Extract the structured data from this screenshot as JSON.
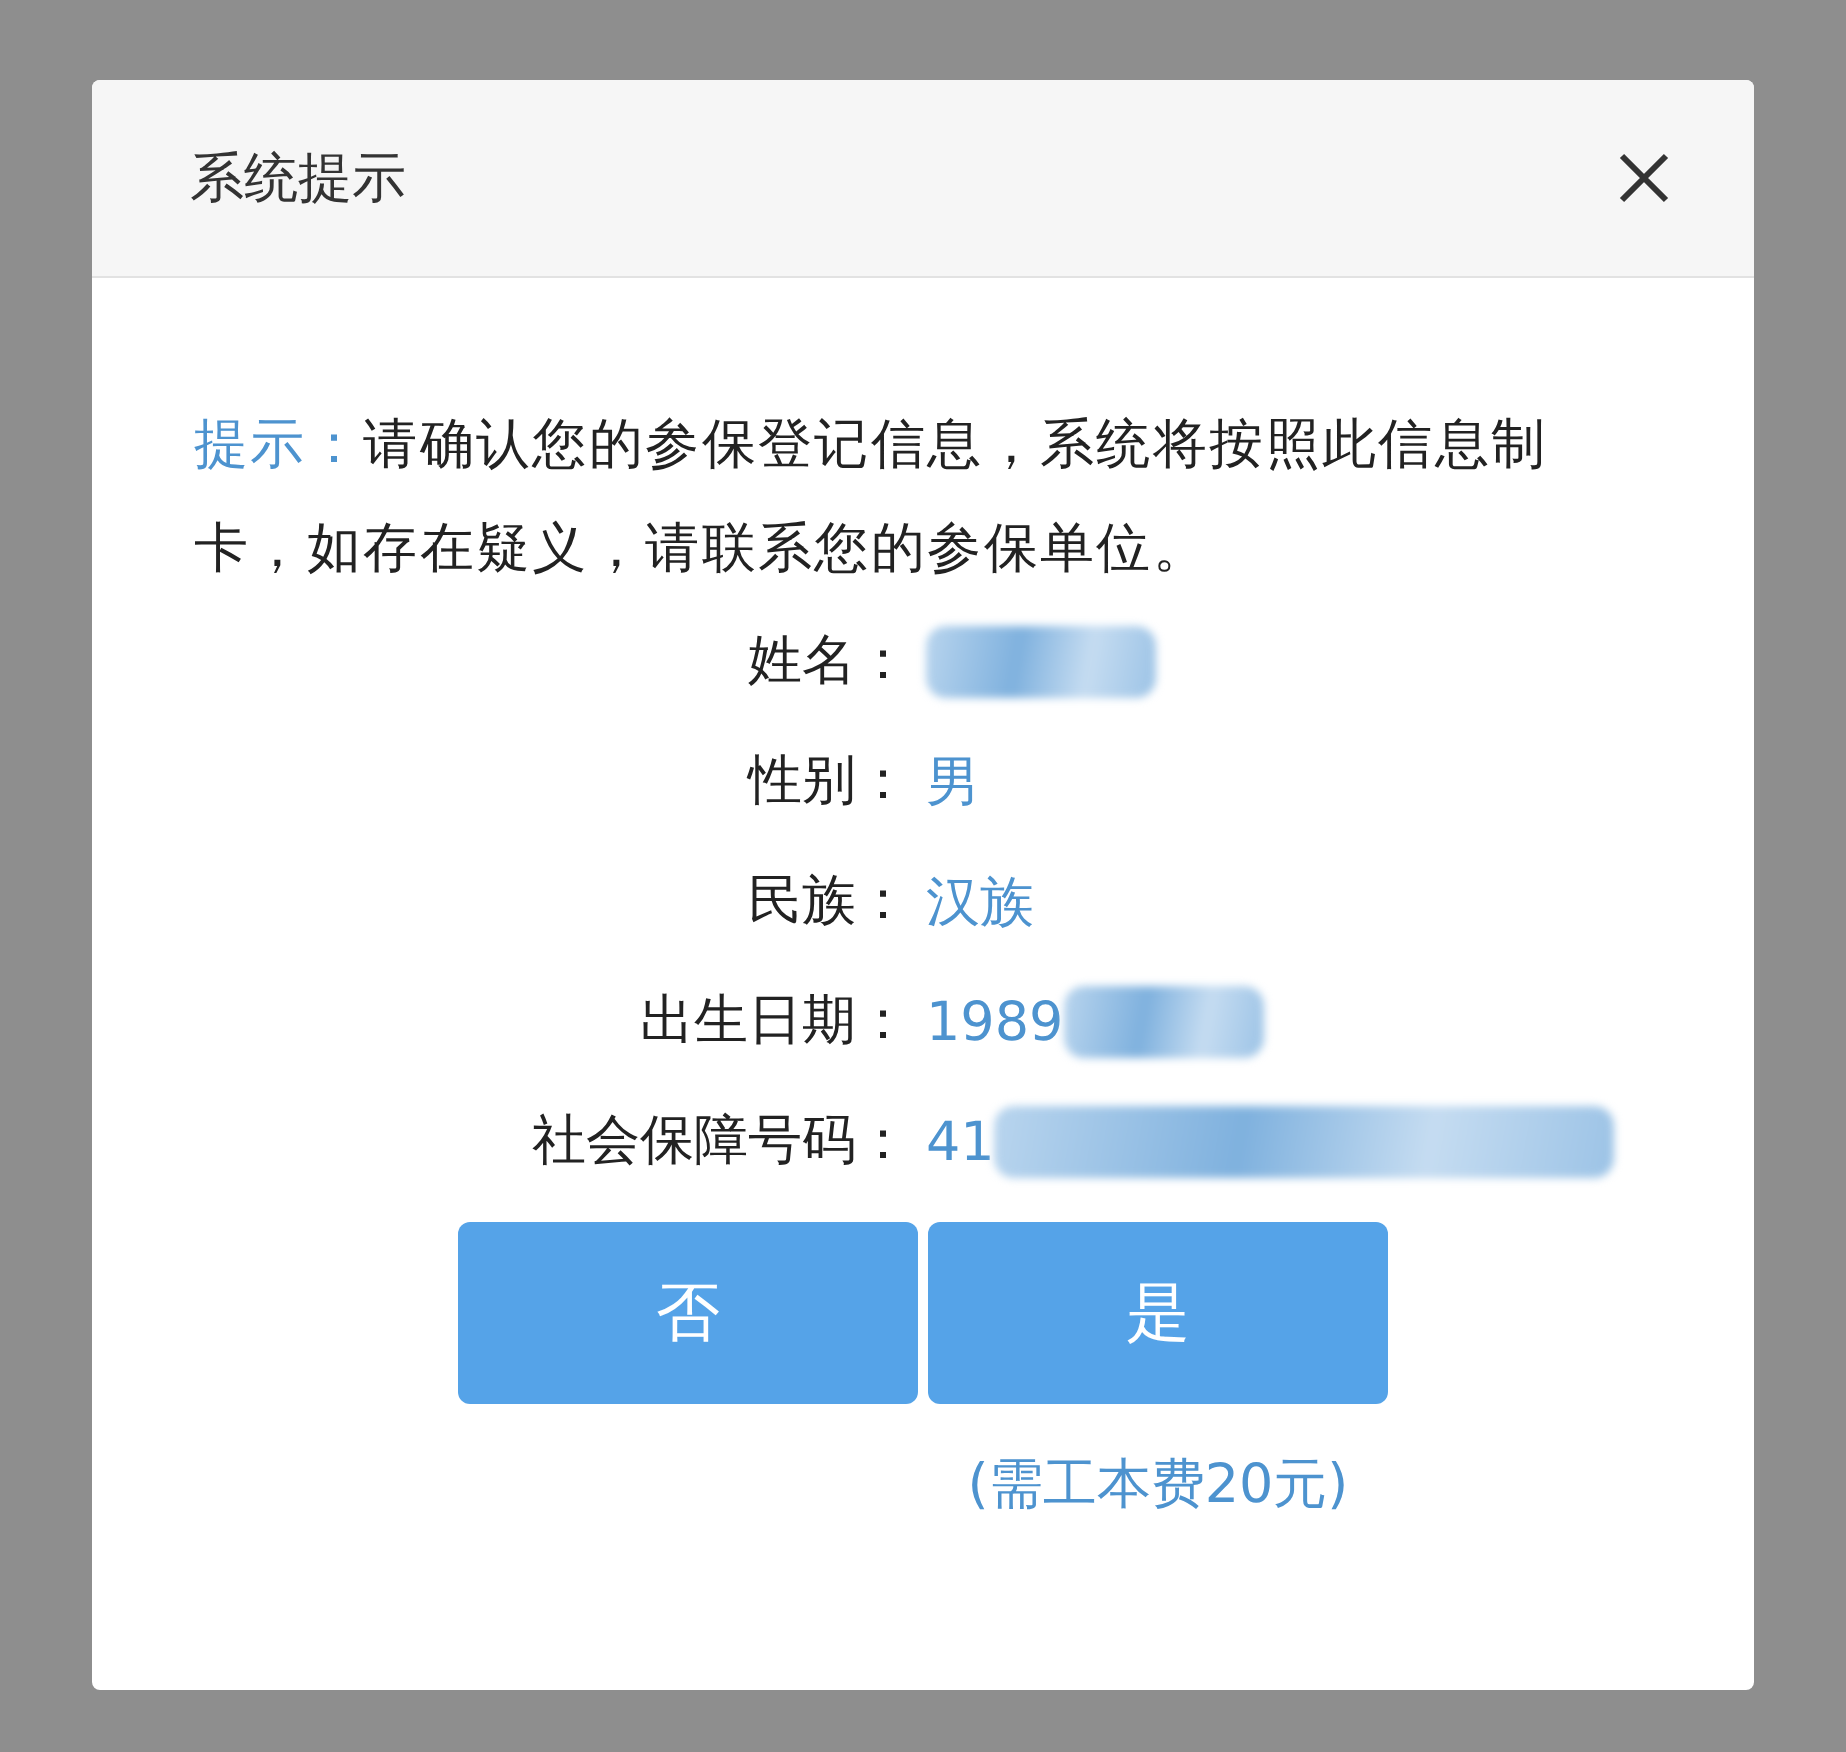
{
  "dialog": {
    "title": "系统提示"
  },
  "message": {
    "label": "提示：",
    "text": "请确认您的参保登记信息，系统将按照此信息制卡，如存在疑义，请联系您的参保单位。"
  },
  "fields": [
    {
      "label": "姓名：",
      "redacted": true
    },
    {
      "label": "性别：",
      "value": "男",
      "redacted": false
    },
    {
      "label": "民族：",
      "value": "汉族",
      "redacted": false
    },
    {
      "label": "出生日期：",
      "value": "1989",
      "redacted": true
    },
    {
      "label": "社会保障号码：",
      "value": "41",
      "redacted": true
    }
  ],
  "buttons": [
    {
      "label": "否"
    },
    {
      "label": "是"
    }
  ],
  "note": "(需工本费20元)"
}
